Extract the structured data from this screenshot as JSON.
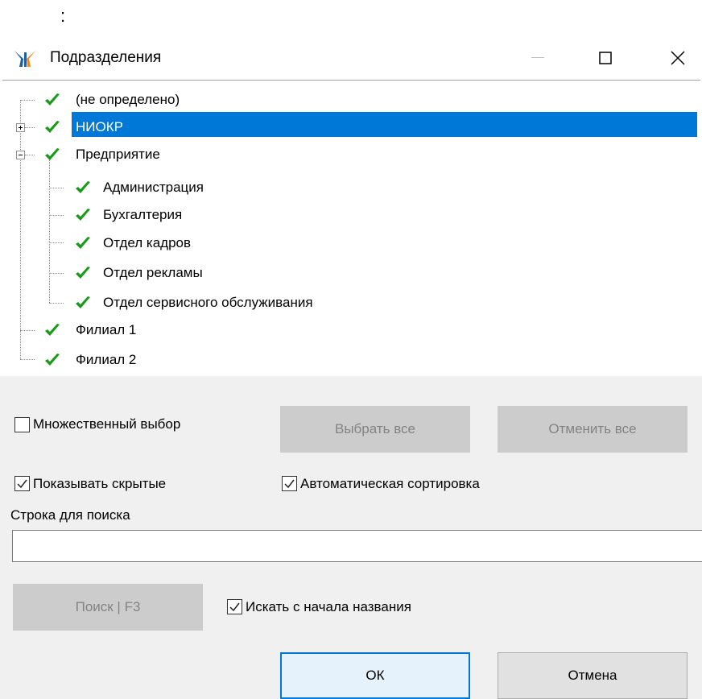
{
  "page": {
    "stray_text": ":"
  },
  "window": {
    "title": "Подразделения",
    "minimize_glyph": "—",
    "maximize_glyph": "☐",
    "close_glyph": "✕"
  },
  "tree": {
    "nodes": [
      {
        "label": "(не определено)",
        "level": 0,
        "expander": "none",
        "selected": false,
        "checked": true
      },
      {
        "label": "НИОКР",
        "level": 0,
        "expander": "plus",
        "selected": true,
        "checked": true
      },
      {
        "label": "Предприятие",
        "level": 0,
        "expander": "minus",
        "selected": false,
        "checked": true
      },
      {
        "label": "Администрация",
        "level": 1,
        "expander": "none",
        "selected": false,
        "checked": true
      },
      {
        "label": "Бухгалтерия",
        "level": 1,
        "expander": "none",
        "selected": false,
        "checked": true
      },
      {
        "label": "Отдел кадров",
        "level": 1,
        "expander": "none",
        "selected": false,
        "checked": true
      },
      {
        "label": "Отдел рекламы",
        "level": 1,
        "expander": "none",
        "selected": false,
        "checked": true
      },
      {
        "label": "Отдел сервисного обслуживания",
        "level": 1,
        "expander": "none",
        "selected": false,
        "checked": true
      },
      {
        "label": "Филиал 1",
        "level": 0,
        "expander": "none",
        "selected": false,
        "checked": true
      },
      {
        "label": "Филиал 2",
        "level": 0,
        "expander": "none",
        "selected": false,
        "checked": true
      }
    ],
    "check_color": "#1a9a1a",
    "selection_color": "#0078d7"
  },
  "options": {
    "multi_select": {
      "label": "Множественный выбор",
      "checked": false
    },
    "select_all_label": "Выбрать все",
    "deselect_all_label": "Отменить все",
    "show_hidden": {
      "label": "Показывать скрытые",
      "checked": true
    },
    "auto_sort": {
      "label": "Автоматическая сортировка",
      "checked": true
    }
  },
  "search": {
    "label": "Строка для поиска",
    "value": "",
    "button_label": "Поиск | F3",
    "from_start": {
      "label": "Искать с начала названия",
      "checked": true
    }
  },
  "dialog_buttons": {
    "ok_label": "ОК",
    "cancel_label": "Отмена"
  }
}
